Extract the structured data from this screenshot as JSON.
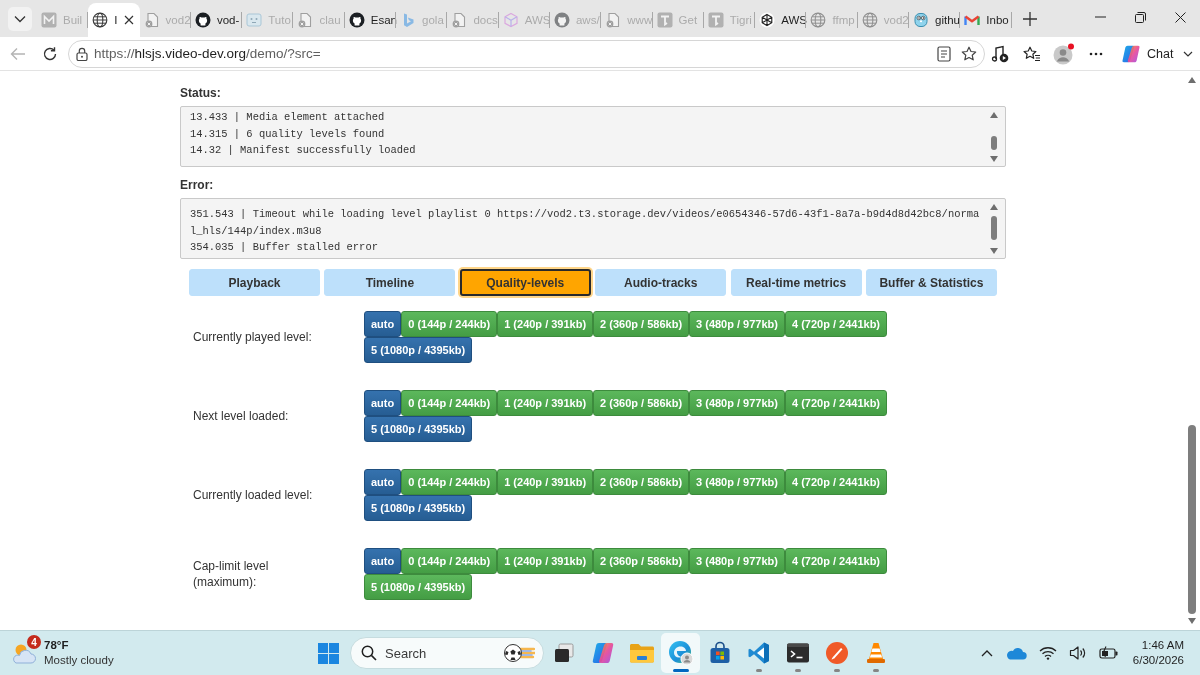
{
  "browser": {
    "tabs": [
      {
        "kind": "tile-m",
        "title": "Buil",
        "selected": false,
        "sleeping": true
      },
      {
        "kind": "globe",
        "title": "I",
        "selected": true,
        "sleeping": false
      },
      {
        "kind": "document",
        "title": "vod2",
        "selected": false,
        "sleeping": true
      },
      {
        "kind": "github",
        "title": "vod-",
        "selected": false,
        "sleeping": false
      },
      {
        "kind": "screen",
        "title": "Tuto",
        "selected": false,
        "sleeping": true
      },
      {
        "kind": "document",
        "title": "clau",
        "selected": false,
        "sleeping": true
      },
      {
        "kind": "github",
        "title": "Esan",
        "selected": false,
        "sleeping": false
      },
      {
        "kind": "bing",
        "title": "gola",
        "selected": false,
        "sleeping": true
      },
      {
        "kind": "document",
        "title": "docs",
        "selected": false,
        "sleeping": true
      },
      {
        "kind": "cube",
        "title": "AWS",
        "selected": false,
        "sleeping": true
      },
      {
        "kind": "github",
        "title": "aws/",
        "selected": false,
        "sleeping": true
      },
      {
        "kind": "document",
        "title": "www",
        "selected": false,
        "sleeping": true
      },
      {
        "kind": "tile-t",
        "title": "Get",
        "selected": false,
        "sleeping": true
      },
      {
        "kind": "tile-t",
        "title": "Tigri",
        "selected": false,
        "sleeping": true
      },
      {
        "kind": "knot",
        "title": "AWS",
        "selected": false,
        "sleeping": false
      },
      {
        "kind": "globe",
        "title": "ffmp",
        "selected": false,
        "sleeping": true
      },
      {
        "kind": "globe",
        "title": "vod2",
        "selected": false,
        "sleeping": true
      },
      {
        "kind": "gopher",
        "title": "githu",
        "selected": false,
        "sleeping": false
      },
      {
        "kind": "mail",
        "title": "Inbo",
        "selected": false,
        "sleeping": false
      }
    ],
    "address": {
      "scheme": "https://",
      "host": "hlsjs.video-dev.org",
      "path": "/demo/?src="
    },
    "chat_button": "Chat"
  },
  "page": {
    "status": {
      "label": "Status:",
      "lines": [
        "13.433 | Media element attached",
        "14.315 | 6 quality levels found",
        "14.32 | Manifest successfully loaded"
      ]
    },
    "error": {
      "label": "Error:",
      "lines": [
        "351.543 | Timeout while loading level playlist 0 https://vod2.t3.storage.dev/videos/e0654346-57d6-43f1-8a7a-b9d4d8d42bc8/normal_hls/144p/index.m3u8",
        "354.035 | Buffer stalled error"
      ]
    },
    "tabs": [
      {
        "label": "Playback",
        "selected": false
      },
      {
        "label": "Timeline",
        "selected": false
      },
      {
        "label": "Quality-levels",
        "selected": true
      },
      {
        "label": "Audio-tracks",
        "selected": false
      },
      {
        "label": "Real-time metrics",
        "selected": false
      },
      {
        "label": "Buffer & Statistics",
        "selected": false
      }
    ],
    "level_groups": [
      {
        "label": "Currently played level:",
        "levels": [
          {
            "label": "auto",
            "selected": true
          },
          {
            "label": "0 (144p / 244kb)",
            "selected": false
          },
          {
            "label": "1 (240p / 391kb)",
            "selected": false
          },
          {
            "label": "2 (360p / 586kb)",
            "selected": false
          },
          {
            "label": "3 (480p / 977kb)",
            "selected": false
          },
          {
            "label": "4 (720p / 2441kb)",
            "selected": false
          },
          {
            "label": "5 (1080p / 4395kb)",
            "selected": true
          }
        ]
      },
      {
        "label": "Next level loaded:",
        "levels": [
          {
            "label": "auto",
            "selected": true
          },
          {
            "label": "0 (144p / 244kb)",
            "selected": false
          },
          {
            "label": "1 (240p / 391kb)",
            "selected": false
          },
          {
            "label": "2 (360p / 586kb)",
            "selected": false
          },
          {
            "label": "3 (480p / 977kb)",
            "selected": false
          },
          {
            "label": "4 (720p / 2441kb)",
            "selected": false
          },
          {
            "label": "5 (1080p / 4395kb)",
            "selected": true
          }
        ]
      },
      {
        "label": "Currently loaded level:",
        "levels": [
          {
            "label": "auto",
            "selected": true
          },
          {
            "label": "0 (144p / 244kb)",
            "selected": false
          },
          {
            "label": "1 (240p / 391kb)",
            "selected": false
          },
          {
            "label": "2 (360p / 586kb)",
            "selected": false
          },
          {
            "label": "3 (480p / 977kb)",
            "selected": false
          },
          {
            "label": "4 (720p / 2441kb)",
            "selected": false
          },
          {
            "label": "5 (1080p / 4395kb)",
            "selected": true
          }
        ]
      },
      {
        "label": "Cap-limit level (maximum):",
        "levels": [
          {
            "label": "auto",
            "selected": true
          },
          {
            "label": "0 (144p / 244kb)",
            "selected": false
          },
          {
            "label": "1 (240p / 391kb)",
            "selected": false
          },
          {
            "label": "2 (360p / 586kb)",
            "selected": false
          },
          {
            "label": "3 (480p / 977kb)",
            "selected": false
          },
          {
            "label": "4 (720p / 2441kb)",
            "selected": false
          },
          {
            "label": "5 (1080p / 4395kb)",
            "selected": false
          }
        ]
      }
    ]
  },
  "taskbar": {
    "weather": {
      "badge": "4",
      "temperature": "78°F",
      "condition": "Mostly cloudy"
    },
    "search": {
      "placeholder": "Search"
    },
    "apps": [
      {
        "kind": "task-view",
        "running": false,
        "selected": false
      },
      {
        "kind": "copilot",
        "running": false,
        "selected": false
      },
      {
        "kind": "folder",
        "running": false,
        "selected": false
      },
      {
        "kind": "edge",
        "running": true,
        "selected": true
      },
      {
        "kind": "store",
        "running": false,
        "selected": false
      },
      {
        "kind": "vscode",
        "running": true,
        "selected": false
      },
      {
        "kind": "terminal",
        "running": true,
        "selected": false
      },
      {
        "kind": "pen",
        "running": true,
        "selected": false
      },
      {
        "kind": "vlc",
        "running": true,
        "selected": false
      }
    ],
    "clock": {
      "time": "1:46 AM",
      "date": "6/30/2026"
    }
  }
}
